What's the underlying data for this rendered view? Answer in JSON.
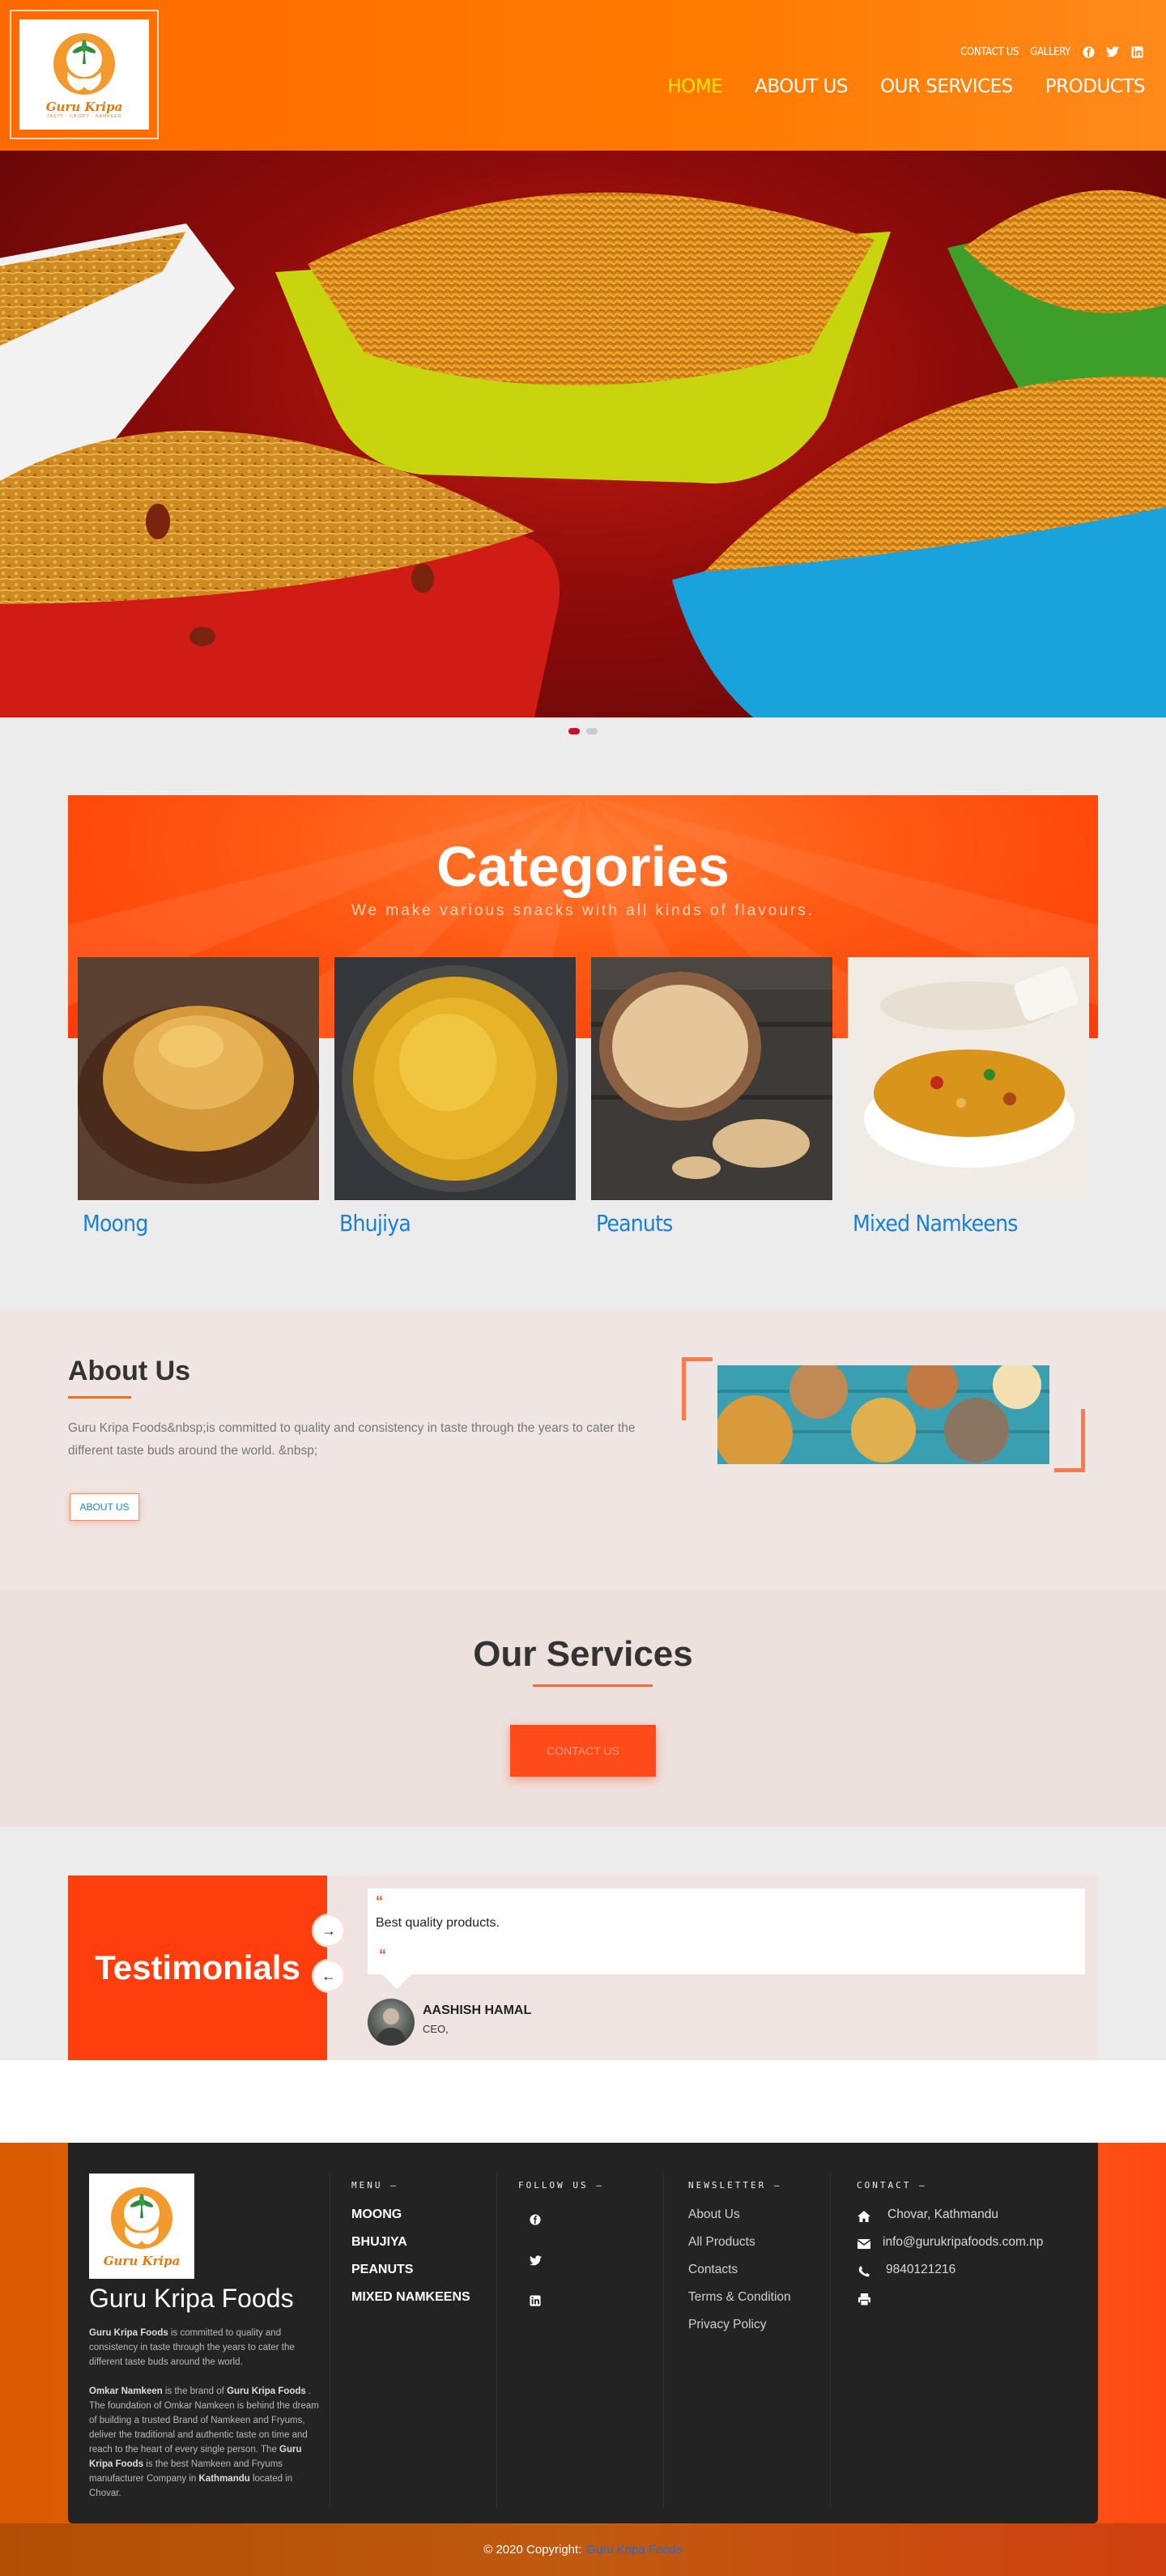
{
  "header": {
    "logo_text": "Guru Kripa",
    "logo_sub": "TASTY · CRISPY · NAMKEEN",
    "top_links": [
      "CONTACT US",
      "GALLERY"
    ],
    "social_icons": [
      "facebook-icon",
      "twitter-icon",
      "linkedin-icon"
    ],
    "nav": [
      {
        "label": "HOME",
        "active": true
      },
      {
        "label": "ABOUT US",
        "active": false
      },
      {
        "label": "OUR SERVICES",
        "active": false
      },
      {
        "label": "PRODUCTS",
        "active": false
      }
    ]
  },
  "slider": {
    "slide_count": 2,
    "active_index": 0
  },
  "categories": {
    "title": "Categories",
    "subtitle": "We make various snacks with all kinds of flavours.",
    "items": [
      {
        "name": "Moong"
      },
      {
        "name": "Bhujiya"
      },
      {
        "name": "Peanuts"
      },
      {
        "name": "Mixed Namkeens"
      }
    ]
  },
  "about": {
    "title": "About Us",
    "text": "Guru Kripa Foods&nbsp;is committed to quality and consistency in taste through the years to cater the different taste buds around the world. &nbsp;",
    "button": "ABOUT US"
  },
  "services": {
    "title": "Our Services",
    "button": "CONTACT US"
  },
  "testimonials": {
    "title": "Testimonials",
    "quote": "Best quality products.",
    "name": "AASHISH HAMAL",
    "role": "CEO,"
  },
  "footer": {
    "brand": "Guru Kripa Foods",
    "para1_bold": "Guru Kripa Foods",
    "para1": " is committed to quality and consistency in taste through the years to cater the different taste buds around the world.",
    "para2_b1": "Omkar Namkeen",
    "para2_t1": " is the brand of ",
    "para2_b2": "Guru Kripa Foods",
    "para2_t2": " . The foundation of Omkar Namkeen is behind the dream of building a trusted Brand of Namkeen and Fryums, deliver the traditional and authentic taste on time and reach to the heart of every single person. The ",
    "para2_b3": "Guru Kripa Foods",
    "para2_t3": "  is the best Namkeen and Fryums manufacturer Company in ",
    "para2_b4": "Kathmandu",
    "para2_t4": " located in Chovar.",
    "menu_heading": "MENU —",
    "menu": [
      "MOONG",
      "BHUJIYA",
      "PEANUTS",
      "MIXED NAMKEENS"
    ],
    "follow_heading": "FOLLOW US —",
    "follow_icons": [
      "facebook-icon",
      "twitter-icon",
      "linkedin-icon"
    ],
    "newsletter_heading": "NEWSLETTER —",
    "newsletter": [
      "About Us",
      "All Products",
      "Contacts",
      "Terms & Condition",
      "Privacy Policy"
    ],
    "contact_heading": "CONTACT —",
    "address": "Chovar, Kathmandu",
    "email": "info@gurukripafoods.com.np",
    "phone": "9840121216"
  },
  "copyright": {
    "text": "© 2020 Copyright:",
    "link": "Guru Kripa Foods"
  },
  "colors": {
    "header_orange": "#ff6a00",
    "nav_active": "#ffe600",
    "accent_red": "#ff3d0d",
    "link_blue": "#1a7fd6",
    "footer_dark": "#232323"
  }
}
